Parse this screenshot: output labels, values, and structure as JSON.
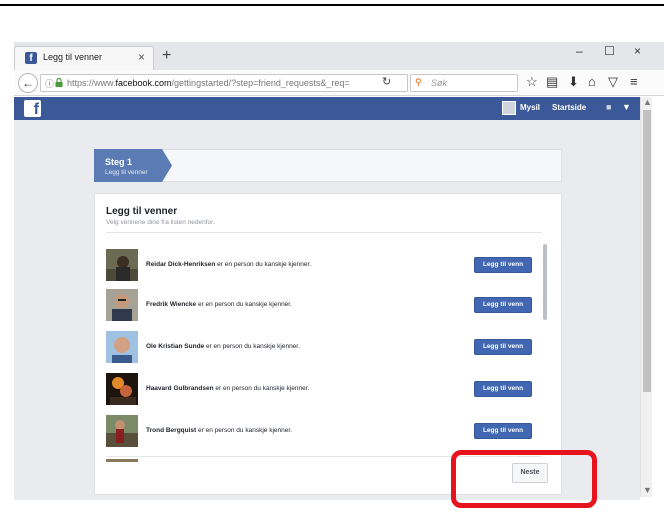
{
  "browser": {
    "tab_title": "Legg til venner",
    "tab_close": "×",
    "new_tab": "+",
    "favicon_letter": "f",
    "window_controls": [
      "–",
      "☐",
      "×"
    ],
    "url_prefix": "https://www.",
    "url_host": "facebook.com",
    "url_path": "/gettingstarted/?step=friend_requests&_req=",
    "search_placeholder": "Søk",
    "icons": [
      "info-icon",
      "lock-icon",
      "reload-icon",
      "star-icon",
      "clipboard-icon",
      "download-icon",
      "home-icon",
      "pocket-icon",
      "menu-icon"
    ]
  },
  "fbbar": {
    "logo": "f",
    "user_name": "Mysil",
    "home_label": "Startside"
  },
  "steps": {
    "title": "Steg 1",
    "subtitle": "Legg til venner"
  },
  "card": {
    "title": "Legg til venner",
    "subtitle": "Velg vennene dine fra listen nedenfor."
  },
  "friends": [
    {
      "name": "Reidar Dick-Henriksen",
      "suffix": " er en person du kanskje kjenner.",
      "button": "Legg til venn",
      "photo": "#6b6a52"
    },
    {
      "name": "Fredrik Wiencke",
      "suffix": " er en person du kanskje kjenner.",
      "button": "Legg til venn",
      "photo": "#8c8576"
    },
    {
      "name": "Ole Kristian Sunde",
      "suffix": " er en person du kanskje kjenner.",
      "button": "Legg til venn",
      "photo": "#7f9fc0"
    },
    {
      "name": "Haavard Gulbrandsen",
      "suffix": " er en person du kanskje kjenner.",
      "button": "Legg til venn",
      "photo": "#9c5a2a"
    },
    {
      "name": "Trond Bergquist",
      "suffix": " er en person du kanskje kjenner.",
      "button": "Legg til venn",
      "photo": "#6f7b5c"
    }
  ],
  "next_label": "Neste",
  "colors": {
    "facebook_blue": "#3b5998",
    "button_blue": "#4267b2",
    "step_blue": "#5b7bb4",
    "highlight_red": "#e8141d"
  }
}
